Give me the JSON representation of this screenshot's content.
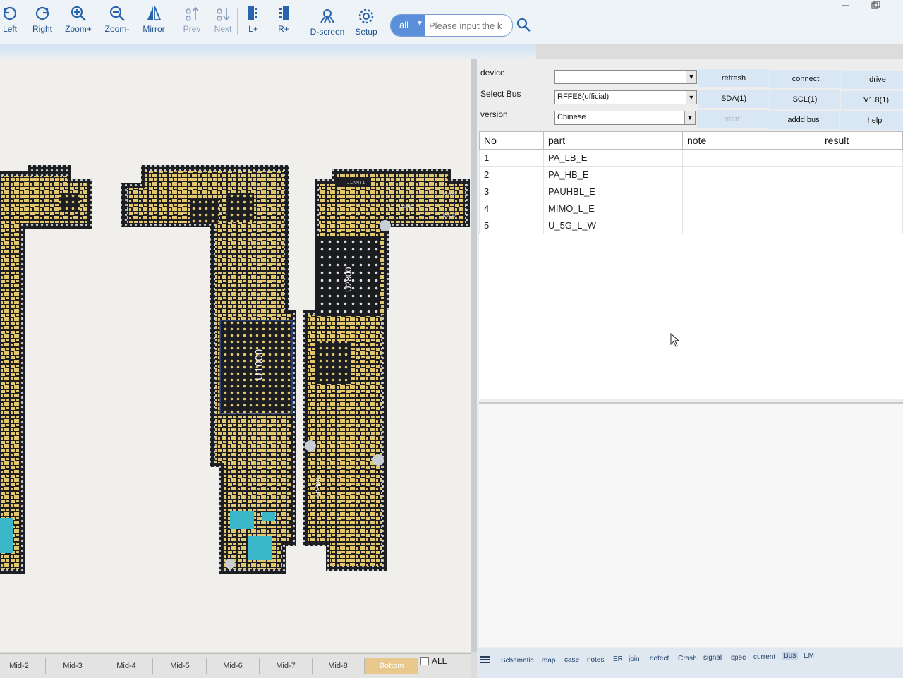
{
  "toolbar": {
    "buttons": [
      {
        "label": "Left",
        "icon": "rotate-left-icon"
      },
      {
        "label": "Right",
        "icon": "rotate-right-icon"
      },
      {
        "label": "Zoom+",
        "icon": "zoom-in-icon"
      },
      {
        "label": "Zoom-",
        "icon": "zoom-out-icon"
      },
      {
        "label": "Mirror",
        "icon": "mirror-icon"
      },
      {
        "label": "Prev",
        "icon": "prev-icon",
        "disabled": true
      },
      {
        "label": "Next",
        "icon": "next-icon",
        "disabled": true
      },
      {
        "label": "L+",
        "icon": "left-layer-icon"
      },
      {
        "label": "R+",
        "icon": "right-layer-icon"
      },
      {
        "label": "D-screen",
        "icon": "dual-screen-icon"
      },
      {
        "label": "Setup",
        "icon": "gear-icon"
      }
    ],
    "search": {
      "scope": "all",
      "placeholder": "Please input the k"
    }
  },
  "board": {
    "chip_labels": [
      "U1000",
      "U2800",
      "U1800",
      "J1ANT1",
      "J10800",
      "J10600",
      "J10200"
    ]
  },
  "panel": {
    "device_label": "device",
    "device_value": "",
    "bus_label": "Select Bus",
    "bus_value": "RFFE6(official)",
    "version_label": "version",
    "version_value": "Chinese",
    "buttons_row1": [
      "refresh",
      "connect",
      "drive"
    ],
    "buttons_row2": [
      "SDA(1)",
      "SCL(1)",
      "V1.8(1)"
    ],
    "buttons_row3": [
      "start",
      "addd bus",
      "help"
    ]
  },
  "table": {
    "headers": [
      "No",
      "part",
      "note",
      "result"
    ],
    "rows": [
      [
        "1",
        "PA_LB_E",
        "",
        ""
      ],
      [
        "2",
        "PA_HB_E",
        "",
        ""
      ],
      [
        "3",
        "PAUHBL_E",
        "",
        ""
      ],
      [
        "4",
        "MIMO_L_E",
        "",
        ""
      ],
      [
        "5",
        "U_5G_L_W",
        "",
        ""
      ]
    ]
  },
  "layer_tabs": [
    "Mid-2",
    "Mid-3",
    "Mid-4",
    "Mid-5",
    "Mid-6",
    "Mid-7",
    "Mid-8",
    "Bottom"
  ],
  "layer_all_label": "ALL",
  "func_tabs": [
    "Schematic",
    "map",
    "case",
    "notes",
    "ER",
    "join",
    "detect",
    "Crash",
    "signal",
    "spec",
    "current",
    "Bus",
    "EM"
  ],
  "colors": {
    "board_gold": "#e2c76f",
    "board_dark": "#1c1e22",
    "accent": "#5b8fd9",
    "toolbar_text": "#1c4f8c"
  }
}
